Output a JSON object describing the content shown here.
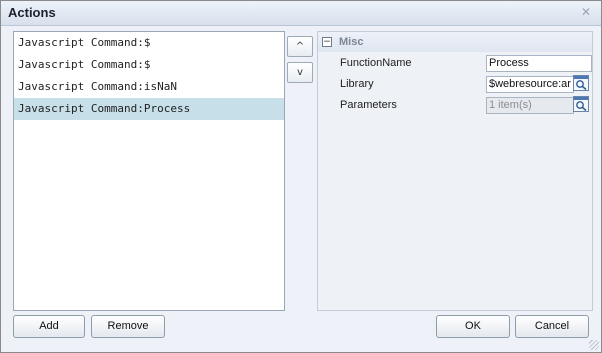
{
  "window": {
    "title": "Actions",
    "close_glyph": "✕"
  },
  "list": {
    "items": [
      {
        "label": "Javascript Command:$",
        "selected": false
      },
      {
        "label": "Javascript Command:$",
        "selected": false
      },
      {
        "label": "Javascript Command:isNaN",
        "selected": false
      },
      {
        "label": "Javascript Command:Process",
        "selected": true
      }
    ]
  },
  "reorder": {
    "up_label": "^",
    "down_label": "v"
  },
  "properties": {
    "category": {
      "toggle": "−",
      "label": "Misc"
    },
    "rows": [
      {
        "name": "FunctionName",
        "value": "Process",
        "readonly": false,
        "has_lookup": false
      },
      {
        "name": "Library",
        "value": "$webresource:ar",
        "readonly": false,
        "has_lookup": true
      },
      {
        "name": "Parameters",
        "value": "1 item(s)",
        "readonly": true,
        "has_lookup": true
      }
    ],
    "lookup_icon": "lookup-icon"
  },
  "buttons": {
    "add": "Add",
    "remove": "Remove",
    "ok": "OK",
    "cancel": "Cancel"
  }
}
